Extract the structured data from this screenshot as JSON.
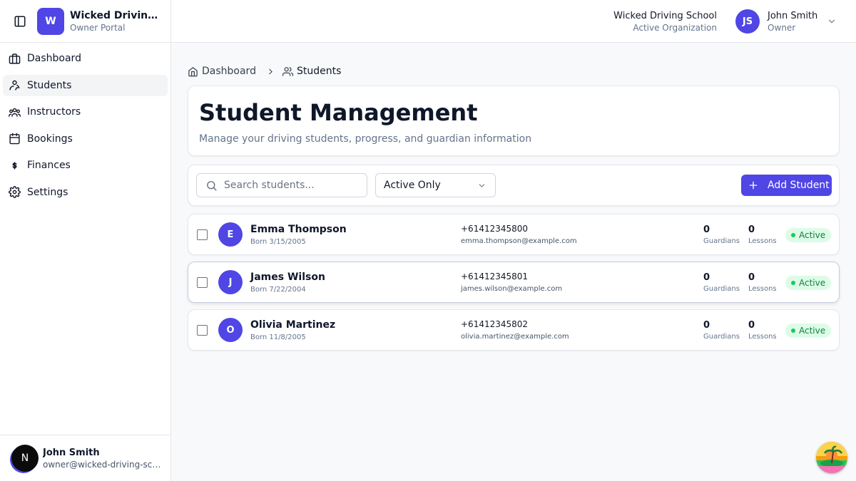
{
  "sidebar": {
    "brand_initial": "W",
    "brand_name": "Wicked Driving School",
    "brand_sub": "Owner Portal",
    "items": [
      {
        "label": "Dashboard",
        "icon": "dashboard-icon"
      },
      {
        "label": "Students",
        "icon": "students-icon",
        "active": true
      },
      {
        "label": "Instructors",
        "icon": "instructors-icon"
      },
      {
        "label": "Bookings",
        "icon": "calendar-icon"
      },
      {
        "label": "Finances",
        "icon": "dollar-icon"
      },
      {
        "label": "Settings",
        "icon": "gear-icon"
      }
    ],
    "user": {
      "initial": "N",
      "name": "John Smith",
      "email": "owner@wicked-driving-school.com"
    }
  },
  "topbar": {
    "org_name": "Wicked Driving School",
    "org_sub": "Active Organization",
    "user_initials": "JS",
    "user_name": "John Smith",
    "user_role": "Owner"
  },
  "breadcrumb": {
    "home": "Dashboard",
    "current": "Students"
  },
  "header": {
    "title": "Student Management",
    "subtitle": "Manage your driving students, progress, and guardian information"
  },
  "filters": {
    "search_placeholder": "Search students...",
    "status_value": "Active Only",
    "add_label": "Add Student"
  },
  "students": [
    {
      "initial": "E",
      "name": "Emma Thompson",
      "born": "Born 3/15/2005",
      "phone": "+61412345800",
      "email": "emma.thompson@example.com",
      "guardians": "0",
      "guardians_label": "Guardians",
      "lessons": "0",
      "lessons_label": "Lessons",
      "status": "Active"
    },
    {
      "initial": "J",
      "name": "James Wilson",
      "born": "Born 7/22/2004",
      "phone": "+61412345801",
      "email": "james.wilson@example.com",
      "guardians": "0",
      "guardians_label": "Guardians",
      "lessons": "0",
      "lessons_label": "Lessons",
      "status": "Active"
    },
    {
      "initial": "O",
      "name": "Olivia Martinez",
      "born": "Born 11/8/2005",
      "phone": "+61412345802",
      "email": "olivia.martinez@example.com",
      "guardians": "0",
      "guardians_label": "Guardians",
      "lessons": "0",
      "lessons_label": "Lessons",
      "status": "Active"
    }
  ],
  "colors": {
    "accent": "#4f46e5",
    "active_badge_bg": "#dcfce7",
    "active_badge_text": "#15803d"
  }
}
